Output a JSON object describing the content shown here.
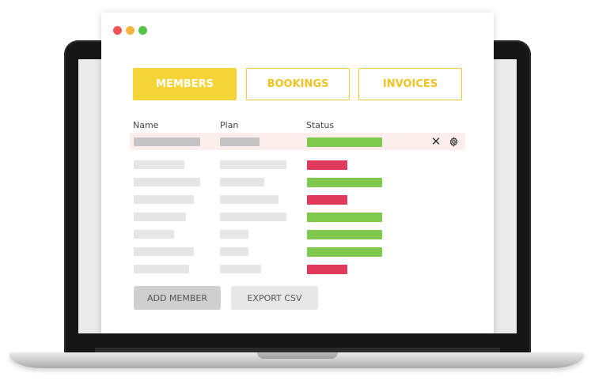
{
  "window": {
    "controls": [
      "close",
      "minimize",
      "maximize"
    ]
  },
  "tabs": [
    {
      "label": "MEMBERS",
      "active": true
    },
    {
      "label": "BOOKINGS",
      "active": false
    },
    {
      "label": "INVOICES",
      "active": false
    }
  ],
  "table": {
    "columns": [
      "Name",
      "Plan",
      "Status"
    ],
    "rows": [
      {
        "name": "redacted",
        "plan": "redacted",
        "status": "active",
        "selected": true,
        "actions": [
          "close-icon",
          "gear-icon"
        ]
      },
      {
        "name": "redacted",
        "plan": "redacted",
        "status": "inactive",
        "selected": false
      },
      {
        "name": "redacted",
        "plan": "redacted",
        "status": "active",
        "selected": false
      },
      {
        "name": "redacted",
        "plan": "redacted",
        "status": "inactive",
        "selected": false
      },
      {
        "name": "redacted",
        "plan": "redacted",
        "status": "active",
        "selected": false
      },
      {
        "name": "redacted",
        "plan": "redacted",
        "status": "active",
        "selected": false
      },
      {
        "name": "redacted",
        "plan": "redacted",
        "status": "active",
        "selected": false
      },
      {
        "name": "redacted",
        "plan": "redacted",
        "status": "inactive",
        "selected": false
      }
    ],
    "delete_glyph": "✕"
  },
  "buttons": {
    "add_member": "ADD MEMBER",
    "export_csv": "EXPORT CSV"
  },
  "colors": {
    "accent": "#f5d437",
    "status_active": "#7ec94e",
    "status_inactive": "#e03a5c",
    "selected_row": "#fdeeee"
  }
}
